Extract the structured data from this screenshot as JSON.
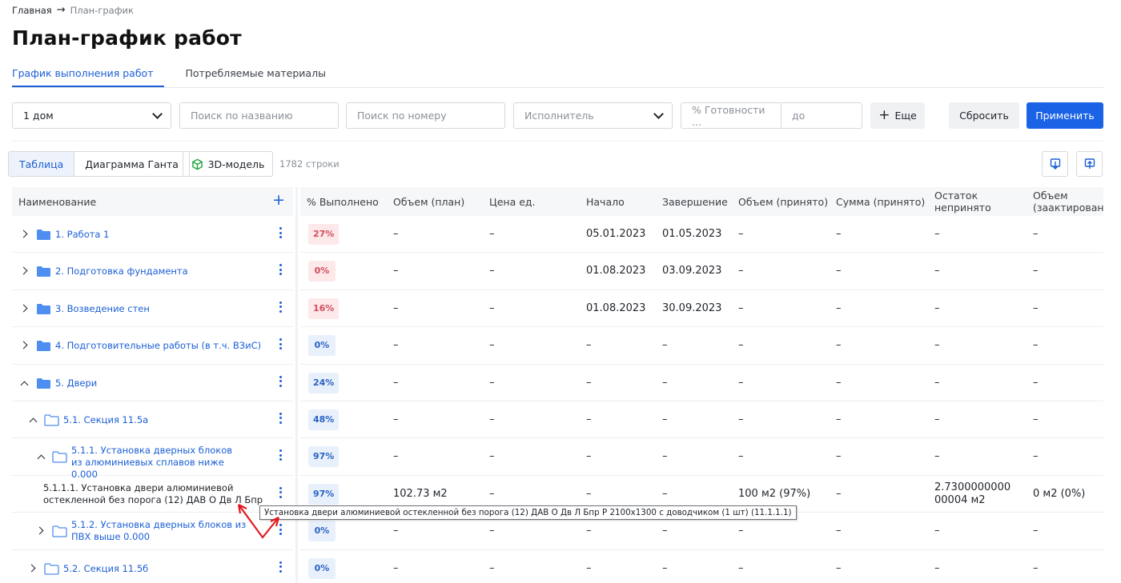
{
  "breadcrumb": {
    "home": "Главная",
    "current": "План-график"
  },
  "page_title": "План-график работ",
  "tabs": [
    {
      "label": "График выполнения работ",
      "active": true
    },
    {
      "label": "Потребляемые материалы",
      "active": false
    }
  ],
  "filters": {
    "house_value": "1 дом",
    "search_name_placeholder": "Поиск по названию",
    "search_number_placeholder": "Поиск по номеру",
    "executor_placeholder": "Исполнитель",
    "readiness_from_placeholder": "% Готовности ...",
    "readiness_to_placeholder": "до",
    "more_label": "Еще",
    "reset_label": "Сбросить",
    "apply_label": "Применить"
  },
  "toolbar": {
    "view_table": "Таблица",
    "view_gantt": "Диаграмма Ганта",
    "model3d": "3D-модель",
    "rows_count": "1782 строки"
  },
  "table": {
    "name_header": "Наименование",
    "columns": [
      "% Выполнено",
      "Объем (план)",
      "Цена ед.",
      "Начало",
      "Завершение",
      "Объем (принято)",
      "Сумма (принято)",
      "Остаток непринято",
      "Объем (заактировано)"
    ],
    "rows": [
      {
        "name": "1. Работа 1",
        "pct": "27%",
        "pct_color": "red",
        "plan": "–",
        "price": "–",
        "start": "05.01.2023",
        "end": "01.05.2023",
        "acc": "–",
        "sum": "–",
        "rem": "–",
        "act": "–"
      },
      {
        "name": "2. Подготовка фундамента",
        "pct": "0%",
        "pct_color": "red",
        "plan": "–",
        "price": "–",
        "start": "01.08.2023",
        "end": "03.09.2023",
        "acc": "–",
        "sum": "–",
        "rem": "–",
        "act": "–"
      },
      {
        "name": "3. Возведение стен",
        "pct": "16%",
        "pct_color": "red",
        "plan": "–",
        "price": "–",
        "start": "01.08.2023",
        "end": "30.09.2023",
        "acc": "–",
        "sum": "–",
        "rem": "–",
        "act": "–"
      },
      {
        "name": "4. Подготовительные работы (в т.ч. ВЗиС)",
        "pct": "0%",
        "pct_color": "blue",
        "plan": "–",
        "price": "–",
        "start": "–",
        "end": "–",
        "acc": "–",
        "sum": "–",
        "rem": "–",
        "act": "–"
      },
      {
        "name": "5. Двери",
        "pct": "24%",
        "pct_color": "blue",
        "plan": "–",
        "price": "–",
        "start": "–",
        "end": "–",
        "acc": "–",
        "sum": "–",
        "rem": "–",
        "act": "–"
      },
      {
        "name": "5.1. Секция 11.5а",
        "pct": "48%",
        "pct_color": "blue",
        "plan": "–",
        "price": "–",
        "start": "–",
        "end": "–",
        "acc": "–",
        "sum": "–",
        "rem": "–",
        "act": "–"
      },
      {
        "name": "5.1.1. Установка дверных блоков из алюминиевых сплавов ниже 0.000",
        "pct": "97%",
        "pct_color": "blue",
        "plan": "–",
        "price": "–",
        "start": "–",
        "end": "–",
        "acc": "–",
        "sum": "–",
        "rem": "–",
        "act": "–"
      },
      {
        "name": "5.1.1.1. Установка двери алюминиевой остекленной без порога (12) ДАВ О Дв Л Бпр Р 2100х1300 с...",
        "pct": "97%",
        "pct_color": "blue",
        "plan": "102.73 м2",
        "price": "–",
        "start": "–",
        "end": "–",
        "acc": "100 м2 (97%)",
        "sum": "–",
        "rem": "2.7300000000 00004 м2",
        "act": "0 м2 (0%)"
      },
      {
        "name": "5.1.2. Установка дверных блоков из ПВХ выше 0.000",
        "pct": "0%",
        "pct_color": "blue",
        "plan": "–",
        "price": "–",
        "start": "–",
        "end": "–",
        "acc": "–",
        "sum": "–",
        "rem": "–",
        "act": "–"
      },
      {
        "name": "5.2. Секция 11.5б",
        "pct": "0%",
        "pct_color": "blue",
        "plan": "–",
        "price": "–",
        "start": "–",
        "end": "–",
        "acc": "–",
        "sum": "–",
        "rem": "–",
        "act": "–"
      }
    ]
  },
  "tooltip": "Установка двери алюминиевой остекленной без порога (12) ДАВ О Дв Л Бпр Р 2100х1300 с доводчиком (1 шт) (11.1.1.1)",
  "colors": {
    "accent": "#1b63e6",
    "link": "#1b5fd6",
    "badge_red_bg": "#fde8ea",
    "badge_blue_bg": "#e8f0fb",
    "folder": "#4d8ef0"
  }
}
